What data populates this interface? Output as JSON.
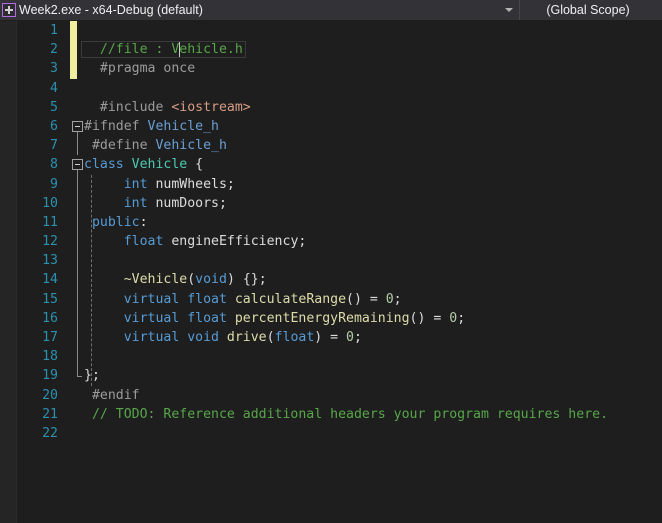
{
  "navbar": {
    "project_icon": "project-cube-icon",
    "project_label": "Week2.exe - x64-Debug (default)",
    "dropdown_icon": "chevron-down-icon",
    "scope_label": "(Global Scope)"
  },
  "editor": {
    "language": "cpp",
    "total_lines": 22,
    "cursor": {
      "line": 2,
      "column": 12
    },
    "colors": {
      "background": "#1e1e1e",
      "indicator_margin": "#252526",
      "line_number": "#2b91af",
      "change_bar_unsaved": "#efef9f",
      "navbar_background": "#333337",
      "comment": "#57a64a",
      "keyword": "#569cd6",
      "type": "#4ec9b0",
      "function": "#dcdcaa",
      "string": "#d69d85",
      "number": "#b5cea8",
      "preprocessor": "#9b9b9b",
      "plain_text": "#dcdcdc"
    },
    "lines": [
      {
        "n": "1",
        "changed": true,
        "fold": "none",
        "tokens": []
      },
      {
        "n": "2",
        "changed": true,
        "fold": "none",
        "tokens": [
          {
            "t": "  //file : Vehicle.h",
            "c": "t-comment"
          }
        ]
      },
      {
        "n": "3",
        "changed": true,
        "fold": "none",
        "tokens": [
          {
            "t": "  #pragma once",
            "c": "t-pp"
          }
        ]
      },
      {
        "n": "4",
        "changed": false,
        "fold": "none",
        "tokens": []
      },
      {
        "n": "5",
        "changed": false,
        "fold": "none",
        "tokens": [
          {
            "t": "  #include ",
            "c": "t-pp"
          },
          {
            "t": "<iostream>",
            "c": "t-str"
          }
        ]
      },
      {
        "n": "6",
        "changed": false,
        "fold": "box",
        "tokens": [
          {
            "t": "#ifndef ",
            "c": "t-pp"
          },
          {
            "t": "Vehicle_h",
            "c": "t-ppid"
          }
        ]
      },
      {
        "n": "7",
        "changed": false,
        "fold": "none",
        "tokens": [
          {
            "t": " #define ",
            "c": "t-pp"
          },
          {
            "t": "Vehicle_h",
            "c": "t-ppid"
          }
        ]
      },
      {
        "n": "8",
        "changed": false,
        "fold": "box",
        "tokens": [
          {
            "t": "class ",
            "c": "t-kw"
          },
          {
            "t": "Vehicle",
            "c": "t-type"
          },
          {
            "t": " {",
            "c": "t-punct"
          }
        ]
      },
      {
        "n": "9",
        "changed": false,
        "fold": "none",
        "tokens": [
          {
            "t": "     ",
            "c": "t-plain"
          },
          {
            "t": "int",
            "c": "t-kw"
          },
          {
            "t": " numWheels;",
            "c": "t-plain"
          }
        ]
      },
      {
        "n": "10",
        "changed": false,
        "fold": "none",
        "tokens": [
          {
            "t": "     ",
            "c": "t-plain"
          },
          {
            "t": "int",
            "c": "t-kw"
          },
          {
            "t": " numDoors;",
            "c": "t-plain"
          }
        ]
      },
      {
        "n": "11",
        "changed": false,
        "fold": "none",
        "tokens": [
          {
            "t": " public",
            "c": "t-kw"
          },
          {
            "t": ":",
            "c": "t-punct"
          }
        ]
      },
      {
        "n": "12",
        "changed": false,
        "fold": "none",
        "tokens": [
          {
            "t": "     ",
            "c": "t-plain"
          },
          {
            "t": "float",
            "c": "t-kw"
          },
          {
            "t": " engineEfficiency;",
            "c": "t-plain"
          }
        ]
      },
      {
        "n": "13",
        "changed": false,
        "fold": "none",
        "tokens": []
      },
      {
        "n": "14",
        "changed": false,
        "fold": "none",
        "tokens": [
          {
            "t": "     ~Vehicle",
            "c": "t-fn"
          },
          {
            "t": "(",
            "c": "t-punct"
          },
          {
            "t": "void",
            "c": "t-kw"
          },
          {
            "t": ") {};",
            "c": "t-punct"
          }
        ]
      },
      {
        "n": "15",
        "changed": false,
        "fold": "none",
        "tokens": [
          {
            "t": "     ",
            "c": "t-plain"
          },
          {
            "t": "virtual float",
            "c": "t-kw"
          },
          {
            "t": " calculateRange",
            "c": "t-fn"
          },
          {
            "t": "() = ",
            "c": "t-punct"
          },
          {
            "t": "0",
            "c": "t-num"
          },
          {
            "t": ";",
            "c": "t-punct"
          }
        ]
      },
      {
        "n": "16",
        "changed": false,
        "fold": "none",
        "tokens": [
          {
            "t": "     ",
            "c": "t-plain"
          },
          {
            "t": "virtual float",
            "c": "t-kw"
          },
          {
            "t": " percentEnergyRemaining",
            "c": "t-fn"
          },
          {
            "t": "() = ",
            "c": "t-punct"
          },
          {
            "t": "0",
            "c": "t-num"
          },
          {
            "t": ";",
            "c": "t-punct"
          }
        ]
      },
      {
        "n": "17",
        "changed": false,
        "fold": "none",
        "tokens": [
          {
            "t": "     ",
            "c": "t-plain"
          },
          {
            "t": "virtual void",
            "c": "t-kw"
          },
          {
            "t": " drive",
            "c": "t-fn"
          },
          {
            "t": "(",
            "c": "t-punct"
          },
          {
            "t": "float",
            "c": "t-kw"
          },
          {
            "t": ") = ",
            "c": "t-punct"
          },
          {
            "t": "0",
            "c": "t-num"
          },
          {
            "t": ";",
            "c": "t-punct"
          }
        ]
      },
      {
        "n": "18",
        "changed": false,
        "fold": "none",
        "tokens": []
      },
      {
        "n": "19",
        "changed": false,
        "fold": "none",
        "tokens": [
          {
            "t": "};",
            "c": "t-punct"
          }
        ]
      },
      {
        "n": "20",
        "changed": false,
        "fold": "none",
        "tokens": [
          {
            "t": " #endif",
            "c": "t-pp"
          }
        ]
      },
      {
        "n": "21",
        "changed": false,
        "fold": "none",
        "tokens": [
          {
            "t": " // TODO: Reference additional headers your program requires here.",
            "c": "t-comment"
          }
        ]
      },
      {
        "n": "22",
        "changed": false,
        "fold": "none",
        "tokens": []
      }
    ]
  }
}
